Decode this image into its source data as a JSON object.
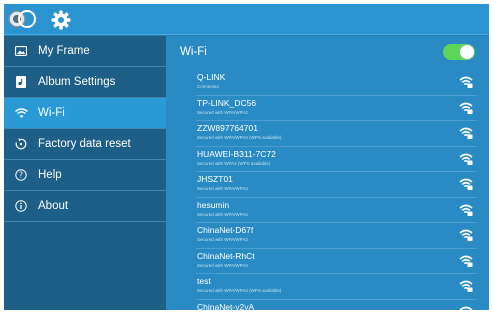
{
  "topbar": {
    "icons": [
      "gallery-icon",
      "gear-icon"
    ]
  },
  "sidebar": {
    "items": [
      {
        "label": "My Frame",
        "icon": "picture-frame-icon",
        "active": false
      },
      {
        "label": "Album Settings",
        "icon": "album-icon",
        "active": false
      },
      {
        "label": "Wi-Fi",
        "icon": "wifi-icon",
        "active": true
      },
      {
        "label": "Factory data reset",
        "icon": "reset-icon",
        "active": false
      },
      {
        "label": "Help",
        "icon": "help-icon",
        "active": false
      },
      {
        "label": "About",
        "icon": "info-icon",
        "active": false
      }
    ]
  },
  "wifi": {
    "title": "Wi-Fi",
    "enabled": true,
    "networks": [
      {
        "name": "Q-LINK",
        "status": "Connected"
      },
      {
        "name": "TP-LINK_DC56",
        "status": "Secured with WPA/WPA2"
      },
      {
        "name": "ZZW897764701",
        "status": "Secured with WPA/WPA2 (WPS available)"
      },
      {
        "name": "HUAWEI-B311-7C72",
        "status": "Secured with WPA2 (WPS available)"
      },
      {
        "name": "JHSZT01",
        "status": "Secured with WPA/WPA2"
      },
      {
        "name": "hesumin",
        "status": "Secured with WPA/WPA2"
      },
      {
        "name": "ChinaNet-D67f",
        "status": "Secured with WPA/WPA2"
      },
      {
        "name": "ChinaNet-RhCt",
        "status": "Secured with WPA/WPA2"
      },
      {
        "name": "test",
        "status": "Secured with WPA/WPA2 (WPS available)"
      },
      {
        "name": "ChinaNet-y2yA",
        "status": ""
      }
    ]
  },
  "colors": {
    "topbar": "#2b93cf",
    "sidebar": "#1d5f86",
    "sidebar_active": "#2a9ad6",
    "main": "#2a8bc4",
    "toggle_on": "#5ed45b"
  }
}
